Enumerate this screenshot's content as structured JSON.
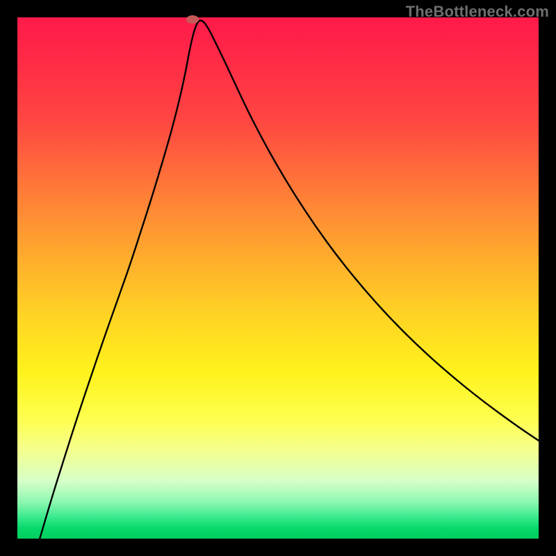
{
  "watermark": "TheBottleneck.com",
  "colors": {
    "curve": "#000000",
    "dot": "#c95a5a",
    "frame": "#000000"
  },
  "chart_data": {
    "type": "line",
    "title": "",
    "xlabel": "",
    "ylabel": "",
    "xlim": [
      0,
      1000
    ],
    "ylim": [
      0,
      1000
    ],
    "series": [
      {
        "name": "curve",
        "x": [
          43,
          65,
          90,
          115,
          140,
          165,
          190,
          215,
          237,
          258,
          277,
          295,
          310,
          322,
          330,
          335,
          340,
          347,
          356,
          367,
          380,
          397,
          417,
          440,
          467,
          498,
          533,
          572,
          615,
          662,
          713,
          768,
          827,
          890,
          957,
          1000
        ],
        "y": [
          0,
          75,
          155,
          233,
          308,
          381,
          452,
          522,
          590,
          655,
          718,
          780,
          838,
          892,
          935,
          958,
          977,
          994,
          994,
          978,
          952,
          917,
          874,
          825,
          772,
          716,
          658,
          599,
          540,
          482,
          425,
          370,
          317,
          266,
          217,
          188
        ]
      }
    ],
    "marker": {
      "x": 336,
      "y": 996
    },
    "gradient_stops": [
      {
        "pos": 0.0,
        "color": "#ff1a4a"
      },
      {
        "pos": 0.08,
        "color": "#ff2a46"
      },
      {
        "pos": 0.2,
        "color": "#ff4742"
      },
      {
        "pos": 0.33,
        "color": "#ff7a38"
      },
      {
        "pos": 0.45,
        "color": "#ffa82e"
      },
      {
        "pos": 0.57,
        "color": "#ffd324"
      },
      {
        "pos": 0.68,
        "color": "#fff21c"
      },
      {
        "pos": 0.77,
        "color": "#feff4e"
      },
      {
        "pos": 0.83,
        "color": "#f4ff8e"
      },
      {
        "pos": 0.89,
        "color": "#d6ffc8"
      },
      {
        "pos": 0.93,
        "color": "#8cf7b0"
      },
      {
        "pos": 0.96,
        "color": "#36e98b"
      },
      {
        "pos": 0.98,
        "color": "#07d96a"
      },
      {
        "pos": 1.0,
        "color": "#00cf5e"
      }
    ]
  }
}
